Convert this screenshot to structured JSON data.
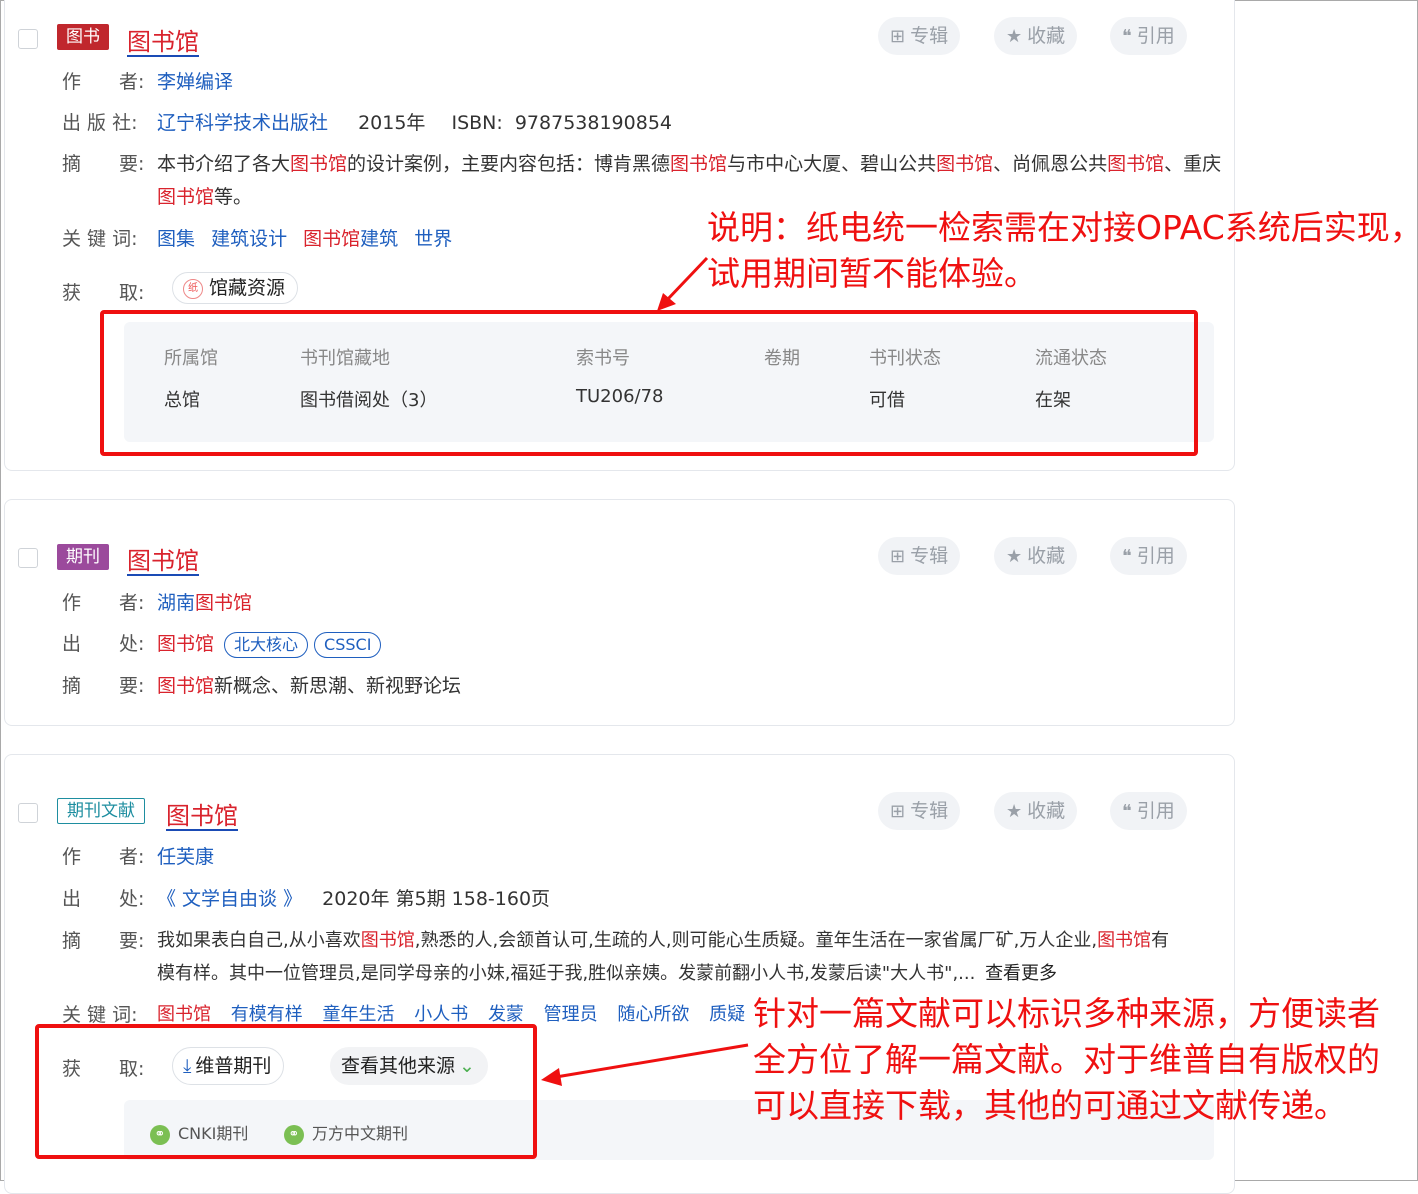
{
  "actions": {
    "album": "专辑",
    "favorite": "收藏",
    "cite": "引用"
  },
  "labels": {
    "author": "作　　者:",
    "publisher": "出 版 社:",
    "abstract": "摘　　要:",
    "keywords": "关 键 词:",
    "obtain": "获　　取:",
    "source": "出　　处:"
  },
  "records": [
    {
      "type": "图书",
      "title": "图书馆",
      "author": "李婵编译",
      "publisher": "辽宁科学技术出版社",
      "year": "2015年",
      "isbn_label": "ISBN:",
      "isbn": "9787538190854",
      "abstract": [
        {
          "t": "本书介绍了各大",
          "h": false
        },
        {
          "t": "图书馆",
          "h": true
        },
        {
          "t": "的设计案例，主要内容包括：博肯黑德",
          "h": false
        },
        {
          "t": "图书馆",
          "h": true
        },
        {
          "t": "与市中心大厦、碧山公共",
          "h": false
        },
        {
          "t": "图书馆",
          "h": true
        },
        {
          "t": "、尚佩恩公共",
          "h": false
        },
        {
          "t": "图书馆",
          "h": true
        },
        {
          "t": "、重庆",
          "h": false
        }
      ],
      "abstract_line2": [
        {
          "t": "图书馆",
          "h": true
        },
        {
          "t": "等。",
          "h": false
        }
      ],
      "keywords": [
        "图集",
        "建筑设计",
        "图书馆建筑",
        "世界"
      ],
      "obtain_button": "馆藏资源",
      "obtain_icon": "library-seal-icon",
      "holdings": {
        "headers": [
          "所属馆",
          "书刊馆藏地",
          "索书号",
          "卷期",
          "书刊状态",
          "流通状态"
        ],
        "row": [
          "总馆",
          "图书借阅处（3）",
          "TU206/78",
          "",
          "可借",
          "在架"
        ]
      }
    },
    {
      "type": "期刊",
      "title": "图书馆",
      "author": "湖南图书馆",
      "source": "图书馆",
      "badges": [
        "北大核心",
        "CSSCI"
      ],
      "abstract_highlight": "图书馆",
      "abstract_rest": "新概念、新思潮、新视野论坛"
    },
    {
      "type": "期刊文献",
      "title": "图书馆",
      "author": "任芙康",
      "source": "《 文学自由谈 》",
      "issue": "2020年 第5期 158-160页",
      "abstract": [
        {
          "t": "我如果表白自己,从小喜欢",
          "h": false
        },
        {
          "t": "图书馆",
          "h": true
        },
        {
          "t": ",熟悉的人,会颔首认可,生疏的人,则可能心生质疑。童年生活在一家省属厂矿,万人企业,",
          "h": false
        },
        {
          "t": "图书馆",
          "h": true
        },
        {
          "t": "有",
          "h": false
        }
      ],
      "abstract_line2": "模有样。其中一位管理员,是同学母亲的小妹,福延于我,胜似亲姨。发蒙前翻小人书,发蒙后读\"大人书\",...",
      "see_more": "查看更多",
      "keywords": [
        "图书馆",
        "有模有样",
        "童年生活",
        "小人书",
        "发蒙",
        "管理员",
        "随心所欲",
        "质疑"
      ],
      "download_button": "维普期刊",
      "other_sources_button": "查看其他来源",
      "sources": [
        "CNKI期刊",
        "万方中文期刊"
      ]
    }
  ],
  "annotations": {
    "note1": [
      "说明：纸电统一检索需在对接OPAC系统后实现，",
      "试用期间暂不能体验。"
    ],
    "note2": [
      "针对一篇文献可以标识多种来源，方便读者",
      "全方位了解一篇文献。对于维普自有版权的",
      "可以直接下载，其他的可通过文献传递。"
    ],
    "color": "#ef1010"
  },
  "colors": {
    "highlight": "#d9232d",
    "link": "#1f5fbf",
    "book_tag": "#c0272d",
    "journal_tag": "#9b4a9c",
    "article_tag": "#1e8ea0"
  }
}
